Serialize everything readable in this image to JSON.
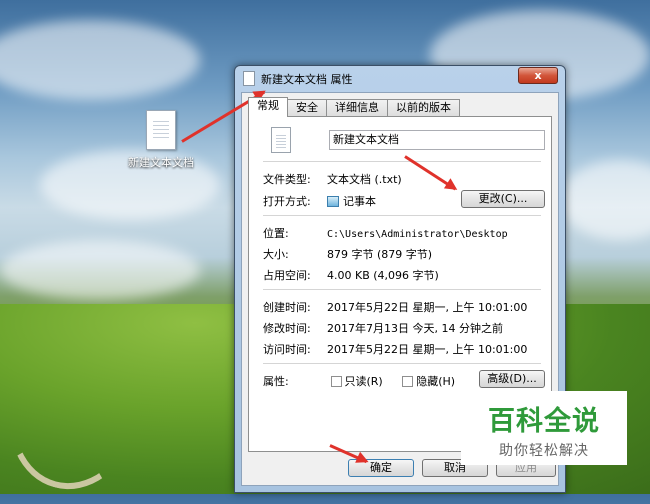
{
  "desktop": {
    "icon_label": "新建文本文档"
  },
  "window": {
    "title": "新建文本文档 属性",
    "close_glyph": "x",
    "tabs": [
      "常规",
      "安全",
      "详细信息",
      "以前的版本"
    ],
    "file_name": "新建文本文档",
    "fields": {
      "type_label": "文件类型:",
      "type_value": "文本文档 (.txt)",
      "open_label": "打开方式:",
      "open_value": "记事本",
      "change_button": "更改(C)...",
      "location_label": "位置:",
      "location_value": "C:\\Users\\Administrator\\Desktop",
      "size_label": "大小:",
      "size_value": "879 字节 (879 字节)",
      "disk_label": "占用空间:",
      "disk_value": "4.00 KB (4,096 字节)",
      "created_label": "创建时间:",
      "created_value": "2017年5月22日 星期一, 上午 10:01:00",
      "modified_label": "修改时间:",
      "modified_value": "2017年7月13日 今天, 14 分钟之前",
      "accessed_label": "访问时间:",
      "accessed_value": "2017年5月22日 星期一, 上午 10:01:00",
      "attr_label": "属性:",
      "readonly_label": "只读(R)",
      "hidden_label": "隐藏(H)",
      "advanced_button": "高级(D)..."
    },
    "buttons": {
      "ok": "确定",
      "cancel": "取消",
      "apply": "应用"
    }
  },
  "watermark": {
    "title": "百科全说",
    "subtitle": "助你轻松解决"
  }
}
